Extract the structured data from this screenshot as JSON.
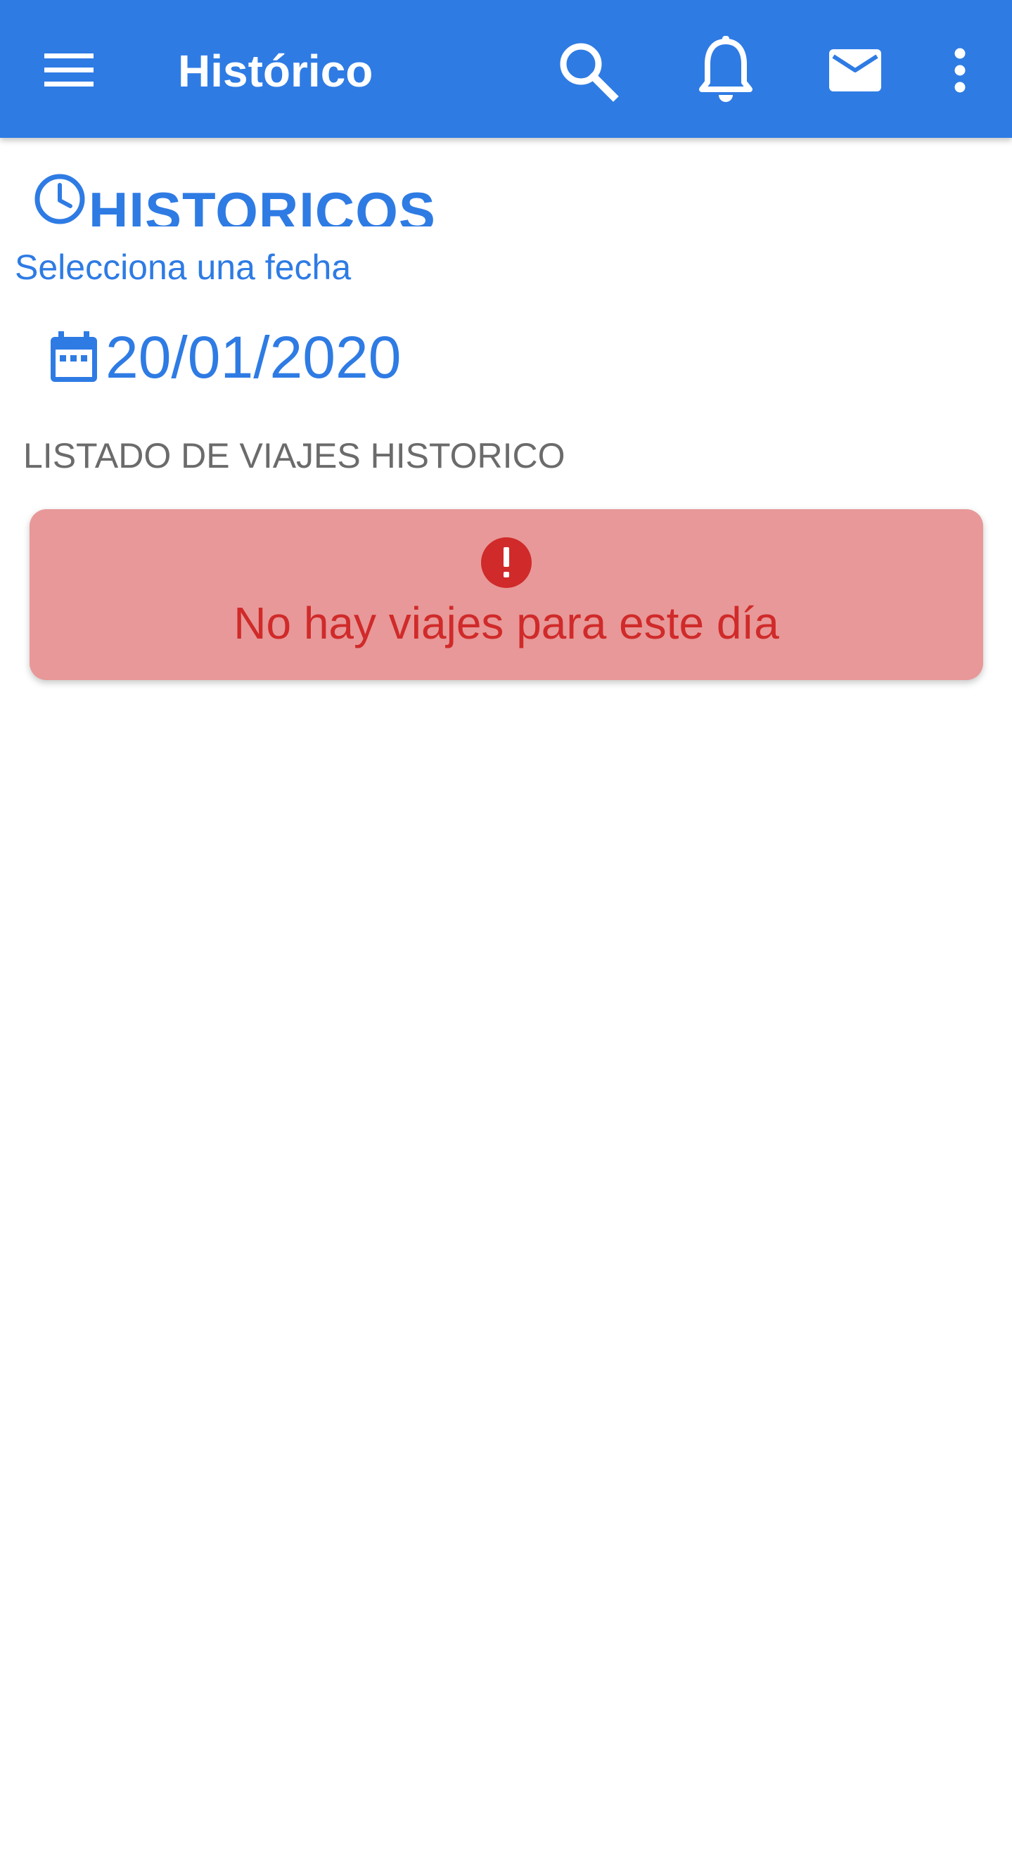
{
  "app_bar": {
    "title": "Histórico",
    "background_color": "#2E7BE4",
    "icons": [
      "menu-icon",
      "search-icon",
      "bell-icon",
      "mail-icon",
      "more-vert-icon"
    ]
  },
  "historicos": {
    "heading": "HISTORICOS",
    "heading_icon": "clock-icon",
    "select_label": "Selecciona una fecha",
    "date_icon": "calendar-icon",
    "selected_date": "20/01/2020"
  },
  "trips": {
    "list_header": "LISTADO DE VIAJES HISTORICO",
    "empty_message": "No hay viajes para este día",
    "empty_icon": "alert-circle-icon",
    "alert_background": "#E89898",
    "alert_text_color": "#D02A2A"
  },
  "colors": {
    "accent": "#2E7BE4",
    "muted_text": "#6b6b6b"
  }
}
